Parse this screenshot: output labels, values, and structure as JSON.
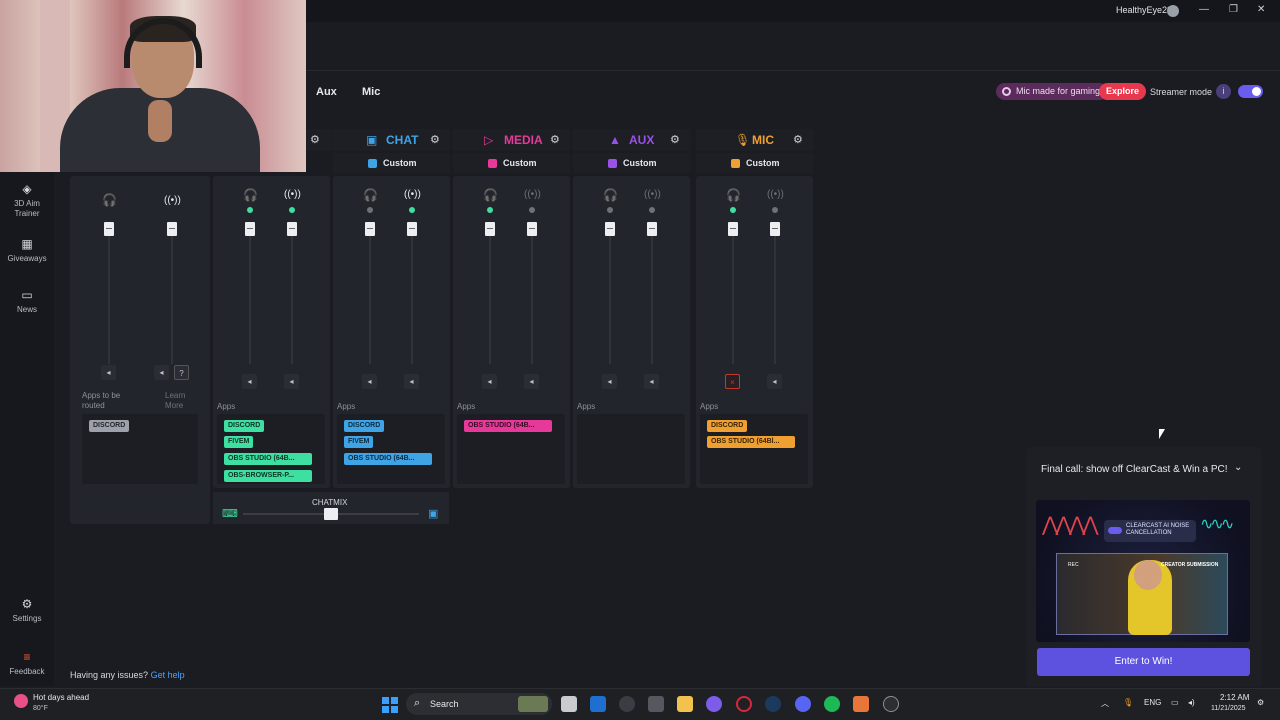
{
  "window": {
    "username": "HealthyEye29",
    "controls": [
      "—",
      "❐",
      "✕"
    ]
  },
  "tabs": [
    "Aux",
    "Mic"
  ],
  "top_right": {
    "mic_promo": "Mic made for gaming",
    "explore": "Explore",
    "streamer_mode": "Streamer mode",
    "info": "i",
    "streamer_toggle_on": true
  },
  "sidebar": [
    {
      "label": "3D Aim\nTrainer",
      "icon": "crosshair-icon"
    },
    {
      "label": "Giveaways",
      "icon": "grid-icon"
    },
    {
      "label": "News",
      "icon": "book-icon"
    },
    {
      "label": "Settings",
      "icon": "gear-icon"
    },
    {
      "label": "Feedback",
      "icon": "feedback-icon"
    }
  ],
  "channels": [
    {
      "name": "CHAT",
      "preset": "Custom",
      "color": "#3fa4e6"
    },
    {
      "name": "MEDIA",
      "preset": "Custom",
      "color": "#e6399a"
    },
    {
      "name": "AUX",
      "preset": "Custom",
      "color": "#9a52e6"
    },
    {
      "name": "MIC",
      "preset": "Custom",
      "color": "#f0a030"
    }
  ],
  "apps_label": "Apps",
  "unrouted": {
    "label": "Apps to be\nrouted",
    "learn_more": "Learn\nMore",
    "apps": [
      "DISCORD"
    ]
  },
  "game_apps": [
    "DISCORD",
    "FIVEM",
    "OBS STUDIO (64B...",
    "OBS-BROWSER-P..."
  ],
  "chat_apps": [
    "DISCORD",
    "FIVEM",
    "OBS STUDIO (64B..."
  ],
  "media_apps": [
    "OBS STUDIO (64B..."
  ],
  "mic_apps": [
    "DISCORD",
    "OBS STUDIO (64Bl..."
  ],
  "chatmix": {
    "label": "CHATMIX",
    "balance": 0.5
  },
  "help": {
    "text": "Having any issues?",
    "link": "Get help"
  },
  "promo": {
    "title": "Final call: show off ClearCast & Win a PC!",
    "pill": "CLEARCAST AI NOISE CANCELLATION",
    "tag": "CREATOR SUBMISSION",
    "rec": "REC",
    "button": "Enter to Win!"
  },
  "taskbar": {
    "weather_title": "Hot days ahead",
    "weather_temp": "80°F",
    "search": "Search",
    "lang": "ENG",
    "time": "2:12 AM",
    "date": "11/21/2025"
  }
}
